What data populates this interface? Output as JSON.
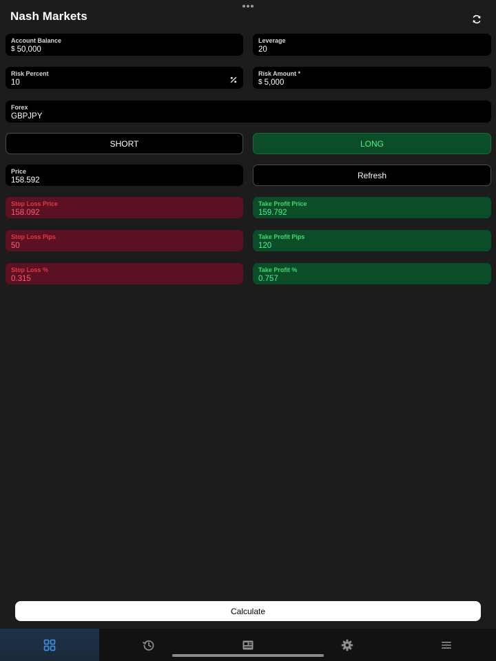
{
  "app": {
    "title": "Nash Markets"
  },
  "fields": {
    "account_balance": {
      "label": "Account Balance",
      "currency": "$",
      "value": "50,000"
    },
    "leverage": {
      "label": "Leverage",
      "value": "20"
    },
    "risk_percent": {
      "label": "Risk Percent",
      "value": "10",
      "suffix_icon": "percent-icon"
    },
    "risk_amount": {
      "label": "Risk Amount *",
      "currency": "$",
      "value": "5,000"
    },
    "forex": {
      "label": "Forex",
      "value": "GBPJPY"
    },
    "price": {
      "label": "Price",
      "value": "158.592"
    },
    "stop_loss_price": {
      "label": "Stop Loss Price",
      "value": "158.092"
    },
    "take_profit_price": {
      "label": "Take Profit Price",
      "value": "159.792"
    },
    "stop_loss_pips": {
      "label": "Stop Loss Pips",
      "value": "50"
    },
    "take_profit_pips": {
      "label": "Take Profit Pips",
      "value": "120"
    },
    "stop_loss_pct": {
      "label": "Stop Loss %",
      "value": "0.315"
    },
    "take_profit_pct": {
      "label": "Take Profit %",
      "value": "0.757"
    }
  },
  "buttons": {
    "short": "SHORT",
    "long": "LONG",
    "refresh": "Refresh",
    "calculate": "Calculate"
  },
  "tabs": [
    {
      "icon": "grid-icon",
      "active": true
    },
    {
      "icon": "history-icon",
      "active": false
    },
    {
      "icon": "news-icon",
      "active": false
    },
    {
      "icon": "gear-icon",
      "active": false
    },
    {
      "icon": "menu-icon",
      "active": false
    }
  ],
  "colors": {
    "background": "#1c1c1c",
    "field": "#000000",
    "loss_bg": "#5a1121",
    "loss_text": "#ff5a73",
    "profit_bg": "#0a4d28",
    "profit_text": "#4ff08a",
    "active_tab": "#1e3247",
    "active_icon": "#3d8fe0"
  }
}
